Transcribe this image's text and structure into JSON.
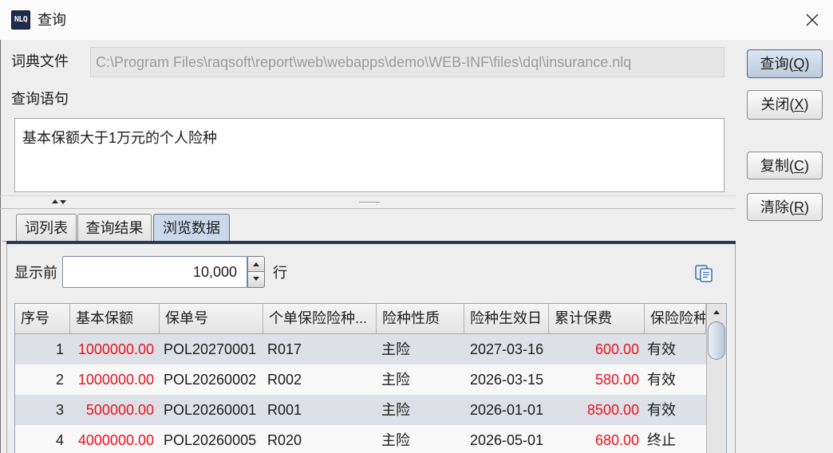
{
  "window": {
    "title": "查询",
    "icon": "nlq-app-icon",
    "icon_text": "NLQ",
    "close_icon": "close-icon"
  },
  "dictionary_file": {
    "label": "词典文件",
    "value": "C:\\Program Files\\raqsoft\\report\\web\\webapps\\demo\\WEB-INF\\files\\dql\\insurance.nlq",
    "disabled": true
  },
  "query_statement": {
    "label": "查询语句",
    "text": "基本保额大于1万元的个人险种"
  },
  "actions": {
    "query": {
      "label": "查询(Q)",
      "mnemonic": "Q",
      "default": true
    },
    "close": {
      "label": "关闭(X)",
      "mnemonic": "X"
    },
    "copy": {
      "label": "复制(C)",
      "mnemonic": "C"
    },
    "clear": {
      "label": "清除(R)",
      "mnemonic": "R"
    }
  },
  "splitter": {
    "expand_icon": "triangle-up-icon",
    "collapse_icon": "triangle-down-icon"
  },
  "tabs": [
    {
      "label": "词列表",
      "selected": false
    },
    {
      "label": "查询结果",
      "selected": false
    },
    {
      "label": "浏览数据",
      "selected": true
    }
  ],
  "browse": {
    "show_first_label": "显示前",
    "row_count": "10,000",
    "unit_label": "行",
    "spinner_icons": [
      "spinner-up-icon",
      "spinner-down-icon"
    ],
    "copy_icon": "copy-data-icon"
  },
  "table": {
    "columns": [
      "序号",
      "基本保额",
      "保单号",
      "个单保险险种...",
      "险种性质",
      "险种生效日",
      "累计保费",
      "保险险种"
    ],
    "rows": [
      [
        "1",
        "1000000.00",
        "POL20270001",
        "R017",
        "主险",
        "2027-03-16",
        "600.00",
        "有效"
      ],
      [
        "2",
        "1000000.00",
        "POL20260002",
        "R002",
        "主险",
        "2026-03-15",
        "580.00",
        "有效"
      ],
      [
        "3",
        "500000.00",
        "POL20260001",
        "R001",
        "主险",
        "2026-01-01",
        "8500.00",
        "有效"
      ],
      [
        "4",
        "4000000.00",
        "POL20260005",
        "R020",
        "主险",
        "2026-05-01",
        "680.00",
        "终止"
      ]
    ],
    "scrollbar_icon": "scroll-up-arrow-icon"
  },
  "colors": {
    "background": "#eeeeee",
    "accent_border": "#4f6384",
    "selected_tab": "#c9d8ea",
    "tab_rule": "#2b3955",
    "numeric_red": "#e8121c",
    "row_alt": "#dde1e7",
    "disabled_text": "#9c9c9c"
  }
}
